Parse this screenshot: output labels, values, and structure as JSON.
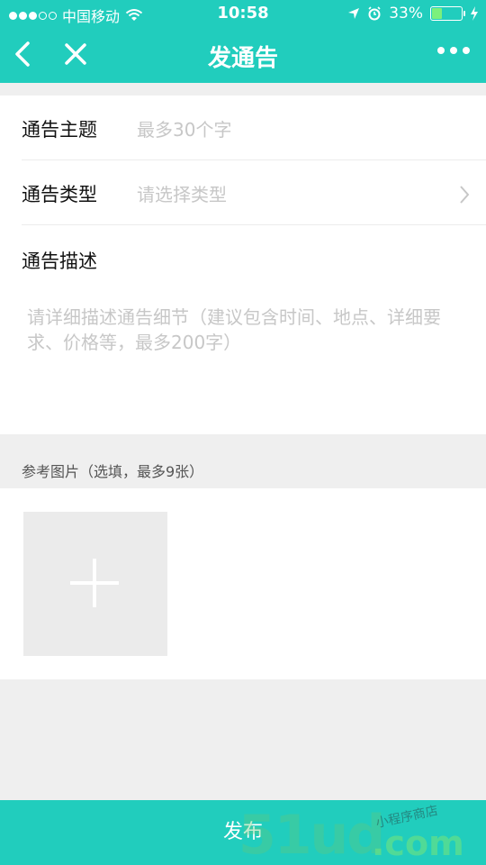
{
  "status_bar": {
    "carrier": "中国移动",
    "time": "10:58",
    "battery": "33%"
  },
  "nav": {
    "title": "发通告"
  },
  "form": {
    "subject_label": "通告主题",
    "subject_placeholder": "最多30个字",
    "type_label": "通告类型",
    "type_placeholder": "请选择类型",
    "description_label": "通告描述",
    "description_placeholder": "请详细描述通告细节（建议包含时间、地点、详细要求、价格等，最多200字）"
  },
  "images": {
    "header": "参考图片（选填，最多9张）"
  },
  "footer": {
    "publish_label": "发布"
  },
  "watermark": {
    "main": "51ud",
    "tag": "小程序商店",
    "domain": ".com"
  },
  "colors": {
    "accent": "#21cdbd",
    "background": "#efefef",
    "placeholder": "#c7c7c7"
  }
}
